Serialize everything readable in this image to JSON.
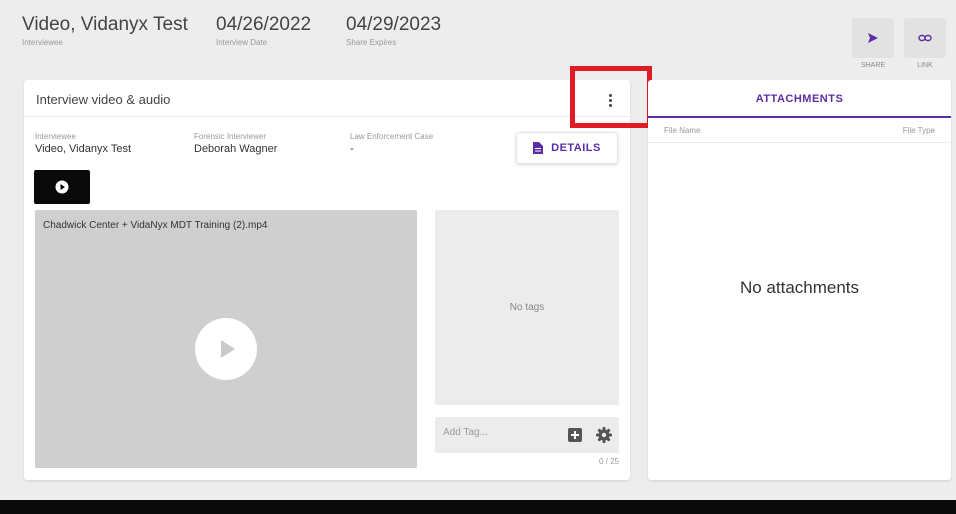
{
  "header": {
    "interviewee": {
      "value": "Video, Vidanyx Test",
      "label": "Interviewee"
    },
    "interview_date": {
      "value": "04/26/2022",
      "label": "Interview Date"
    },
    "share_expires": {
      "value": "04/29/2023",
      "label": "Share Expires"
    },
    "actions": [
      {
        "label": "SHARE",
        "icon": "send-icon"
      },
      {
        "label": "LINK",
        "icon": "link-icon"
      }
    ]
  },
  "video_card": {
    "title": "Interview video & audio",
    "menu_icon": "more-vert-icon",
    "meta": [
      {
        "label": "Interviewee",
        "value": "Video, Vidanyx Test"
      },
      {
        "label": "Forensic Interviewer",
        "value": "Deborah Wagner"
      },
      {
        "label": "Law Enforcement Case",
        "value": "-"
      }
    ],
    "details_button": "DETAILS",
    "video": {
      "filename": "Chadwick Center + VidaNyx MDT Training (2).mp4"
    },
    "tags": {
      "empty_text": "No tags",
      "input_placeholder": "Add Tag...",
      "count": "0 / 25"
    }
  },
  "attachments": {
    "tab_label": "ATTACHMENTS",
    "columns": [
      "File Name",
      "File Type"
    ],
    "empty_text": "No attachments"
  },
  "colors": {
    "accent": "#5b2ea6",
    "highlight": "#e01b24",
    "video_bg": "#cfcfcf",
    "page_bg": "#ededed"
  }
}
